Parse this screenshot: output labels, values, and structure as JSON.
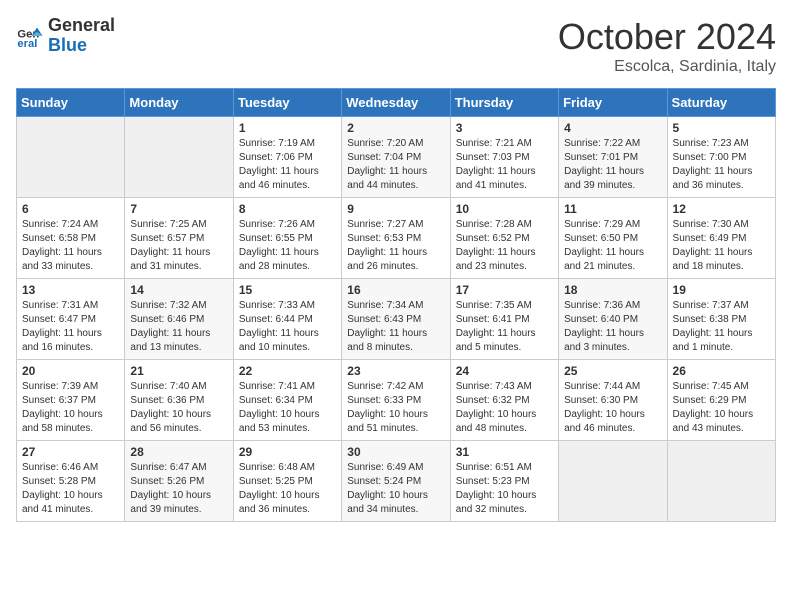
{
  "logo": {
    "line1": "General",
    "line2": "Blue"
  },
  "header": {
    "month": "October 2024",
    "location": "Escolca, Sardinia, Italy"
  },
  "weekdays": [
    "Sunday",
    "Monday",
    "Tuesday",
    "Wednesday",
    "Thursday",
    "Friday",
    "Saturday"
  ],
  "weeks": [
    [
      {
        "day": null
      },
      {
        "day": null
      },
      {
        "day": "1",
        "sunrise": "Sunrise: 7:19 AM",
        "sunset": "Sunset: 7:06 PM",
        "daylight": "Daylight: 11 hours and 46 minutes."
      },
      {
        "day": "2",
        "sunrise": "Sunrise: 7:20 AM",
        "sunset": "Sunset: 7:04 PM",
        "daylight": "Daylight: 11 hours and 44 minutes."
      },
      {
        "day": "3",
        "sunrise": "Sunrise: 7:21 AM",
        "sunset": "Sunset: 7:03 PM",
        "daylight": "Daylight: 11 hours and 41 minutes."
      },
      {
        "day": "4",
        "sunrise": "Sunrise: 7:22 AM",
        "sunset": "Sunset: 7:01 PM",
        "daylight": "Daylight: 11 hours and 39 minutes."
      },
      {
        "day": "5",
        "sunrise": "Sunrise: 7:23 AM",
        "sunset": "Sunset: 7:00 PM",
        "daylight": "Daylight: 11 hours and 36 minutes."
      }
    ],
    [
      {
        "day": "6",
        "sunrise": "Sunrise: 7:24 AM",
        "sunset": "Sunset: 6:58 PM",
        "daylight": "Daylight: 11 hours and 33 minutes."
      },
      {
        "day": "7",
        "sunrise": "Sunrise: 7:25 AM",
        "sunset": "Sunset: 6:57 PM",
        "daylight": "Daylight: 11 hours and 31 minutes."
      },
      {
        "day": "8",
        "sunrise": "Sunrise: 7:26 AM",
        "sunset": "Sunset: 6:55 PM",
        "daylight": "Daylight: 11 hours and 28 minutes."
      },
      {
        "day": "9",
        "sunrise": "Sunrise: 7:27 AM",
        "sunset": "Sunset: 6:53 PM",
        "daylight": "Daylight: 11 hours and 26 minutes."
      },
      {
        "day": "10",
        "sunrise": "Sunrise: 7:28 AM",
        "sunset": "Sunset: 6:52 PM",
        "daylight": "Daylight: 11 hours and 23 minutes."
      },
      {
        "day": "11",
        "sunrise": "Sunrise: 7:29 AM",
        "sunset": "Sunset: 6:50 PM",
        "daylight": "Daylight: 11 hours and 21 minutes."
      },
      {
        "day": "12",
        "sunrise": "Sunrise: 7:30 AM",
        "sunset": "Sunset: 6:49 PM",
        "daylight": "Daylight: 11 hours and 18 minutes."
      }
    ],
    [
      {
        "day": "13",
        "sunrise": "Sunrise: 7:31 AM",
        "sunset": "Sunset: 6:47 PM",
        "daylight": "Daylight: 11 hours and 16 minutes."
      },
      {
        "day": "14",
        "sunrise": "Sunrise: 7:32 AM",
        "sunset": "Sunset: 6:46 PM",
        "daylight": "Daylight: 11 hours and 13 minutes."
      },
      {
        "day": "15",
        "sunrise": "Sunrise: 7:33 AM",
        "sunset": "Sunset: 6:44 PM",
        "daylight": "Daylight: 11 hours and 10 minutes."
      },
      {
        "day": "16",
        "sunrise": "Sunrise: 7:34 AM",
        "sunset": "Sunset: 6:43 PM",
        "daylight": "Daylight: 11 hours and 8 minutes."
      },
      {
        "day": "17",
        "sunrise": "Sunrise: 7:35 AM",
        "sunset": "Sunset: 6:41 PM",
        "daylight": "Daylight: 11 hours and 5 minutes."
      },
      {
        "day": "18",
        "sunrise": "Sunrise: 7:36 AM",
        "sunset": "Sunset: 6:40 PM",
        "daylight": "Daylight: 11 hours and 3 minutes."
      },
      {
        "day": "19",
        "sunrise": "Sunrise: 7:37 AM",
        "sunset": "Sunset: 6:38 PM",
        "daylight": "Daylight: 11 hours and 1 minute."
      }
    ],
    [
      {
        "day": "20",
        "sunrise": "Sunrise: 7:39 AM",
        "sunset": "Sunset: 6:37 PM",
        "daylight": "Daylight: 10 hours and 58 minutes."
      },
      {
        "day": "21",
        "sunrise": "Sunrise: 7:40 AM",
        "sunset": "Sunset: 6:36 PM",
        "daylight": "Daylight: 10 hours and 56 minutes."
      },
      {
        "day": "22",
        "sunrise": "Sunrise: 7:41 AM",
        "sunset": "Sunset: 6:34 PM",
        "daylight": "Daylight: 10 hours and 53 minutes."
      },
      {
        "day": "23",
        "sunrise": "Sunrise: 7:42 AM",
        "sunset": "Sunset: 6:33 PM",
        "daylight": "Daylight: 10 hours and 51 minutes."
      },
      {
        "day": "24",
        "sunrise": "Sunrise: 7:43 AM",
        "sunset": "Sunset: 6:32 PM",
        "daylight": "Daylight: 10 hours and 48 minutes."
      },
      {
        "day": "25",
        "sunrise": "Sunrise: 7:44 AM",
        "sunset": "Sunset: 6:30 PM",
        "daylight": "Daylight: 10 hours and 46 minutes."
      },
      {
        "day": "26",
        "sunrise": "Sunrise: 7:45 AM",
        "sunset": "Sunset: 6:29 PM",
        "daylight": "Daylight: 10 hours and 43 minutes."
      }
    ],
    [
      {
        "day": "27",
        "sunrise": "Sunrise: 6:46 AM",
        "sunset": "Sunset: 5:28 PM",
        "daylight": "Daylight: 10 hours and 41 minutes."
      },
      {
        "day": "28",
        "sunrise": "Sunrise: 6:47 AM",
        "sunset": "Sunset: 5:26 PM",
        "daylight": "Daylight: 10 hours and 39 minutes."
      },
      {
        "day": "29",
        "sunrise": "Sunrise: 6:48 AM",
        "sunset": "Sunset: 5:25 PM",
        "daylight": "Daylight: 10 hours and 36 minutes."
      },
      {
        "day": "30",
        "sunrise": "Sunrise: 6:49 AM",
        "sunset": "Sunset: 5:24 PM",
        "daylight": "Daylight: 10 hours and 34 minutes."
      },
      {
        "day": "31",
        "sunrise": "Sunrise: 6:51 AM",
        "sunset": "Sunset: 5:23 PM",
        "daylight": "Daylight: 10 hours and 32 minutes."
      },
      {
        "day": null
      },
      {
        "day": null
      }
    ]
  ]
}
